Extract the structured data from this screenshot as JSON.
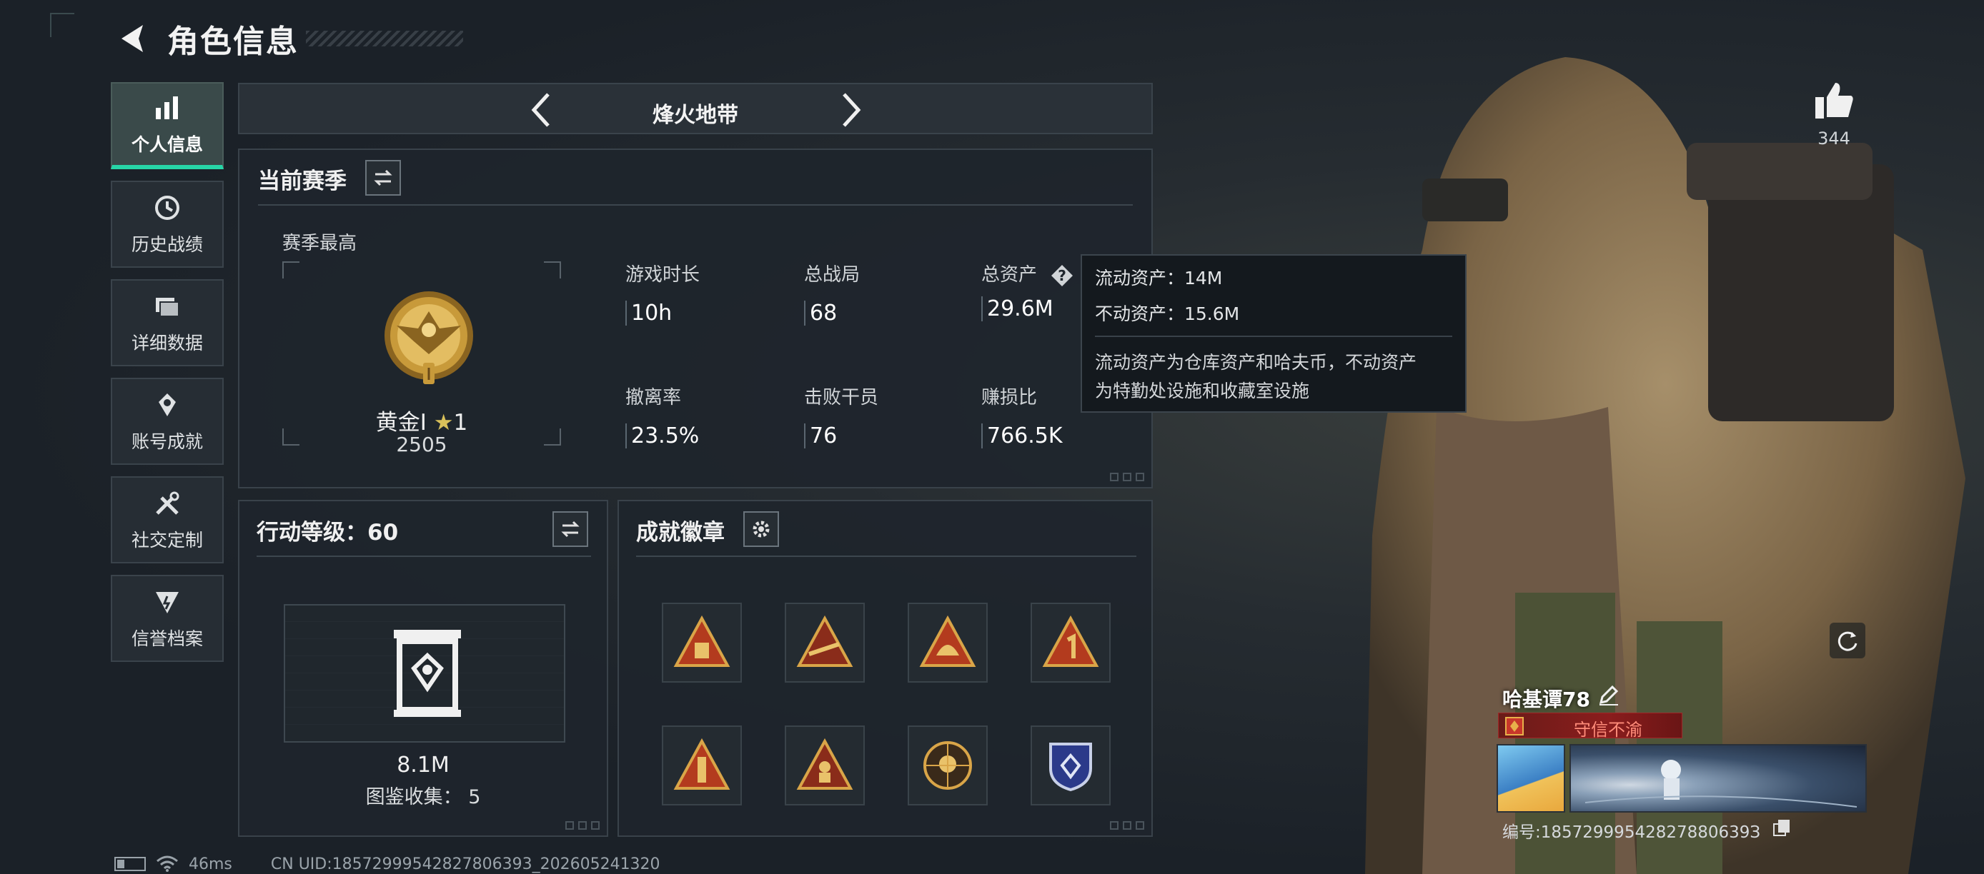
{
  "header": {
    "title": "角色信息"
  },
  "sidebar": {
    "items": [
      {
        "label": "个人信息",
        "icon": "bar-chart-icon",
        "active": true
      },
      {
        "label": "历史战绩",
        "icon": "history-icon"
      },
      {
        "label": "详细数据",
        "icon": "folder-icon"
      },
      {
        "label": "账号成就",
        "icon": "achievement-icon"
      },
      {
        "label": "社交定制",
        "icon": "tools-icon"
      },
      {
        "label": "信誉档案",
        "icon": "credit-icon"
      }
    ]
  },
  "mode": {
    "label": "烽火地带"
  },
  "season": {
    "title": "当前赛季",
    "best_label": "赛季最高",
    "rank": "黄金Ⅰ",
    "star_count": "1",
    "score": "2505",
    "stats": [
      {
        "label": "游戏时长",
        "value": "10h"
      },
      {
        "label": "总战局",
        "value": "68"
      },
      {
        "label": "总资产",
        "value": "29.6M"
      },
      {
        "label": "撤离率",
        "value": "23.5%"
      },
      {
        "label": "击败干员",
        "value": "76"
      },
      {
        "label": "赚损比",
        "value": "766.5K"
      }
    ]
  },
  "tooltip": {
    "liquid": "流动资产：14M",
    "fixed": "不动资产：15.6M",
    "desc_line1": "流动资产为仓库资产和哈夫币，不动资产",
    "desc_line2": "为特勤处设施和收藏室设施"
  },
  "level": {
    "title": "行动等级：60",
    "value": "8.1M",
    "collect": "图鉴收集： 5"
  },
  "badges": {
    "title": "成就徽章",
    "items": [
      "badge-1",
      "badge-2",
      "badge-3",
      "badge-4",
      "badge-5",
      "badge-6",
      "badge-7",
      "badge-8"
    ]
  },
  "profile": {
    "likes": "344",
    "name": "哈基谭78",
    "honor": "守信不渝",
    "id_text": "编号:18572999542827880639З"
  },
  "status": {
    "ping": "46ms",
    "uid": "CN UID:18572999542827806393_202605241320"
  },
  "colors": {
    "accent": "#27d6a7",
    "gold": "#c89a3a",
    "honor_red": "#8a1d1d"
  }
}
